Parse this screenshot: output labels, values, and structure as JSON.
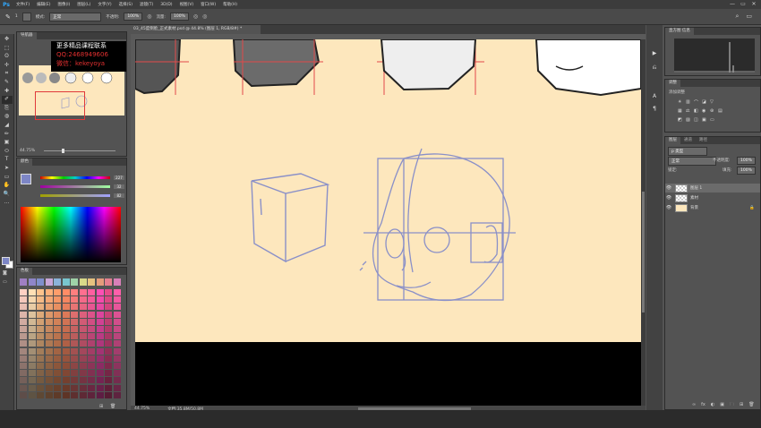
{
  "app": {
    "logo": "Ps",
    "accent": "#31a8ff"
  },
  "menu": [
    "文件(F)",
    "编辑(E)",
    "图像(I)",
    "图层(L)",
    "文字(Y)",
    "选择(S)",
    "滤镜(T)",
    "3D(D)",
    "视图(V)",
    "窗口(W)",
    "帮助(H)"
  ],
  "window_buttons": [
    "—",
    "▭",
    "✕"
  ],
  "options": {
    "brush_size": "1",
    "mode_label": "模式:",
    "mode_value": "正常",
    "opacity_label": "不透明:",
    "opacity_value": "100%",
    "flow_label": "流量:",
    "flow_value": "100%"
  },
  "document": {
    "tab_title": "03_45度侧脸_正式素材.psd @ 44.8% (图层 1, RGB/8#) *",
    "zoom": "44.75%",
    "doc_size": "文档:35.8M/50.8M",
    "canvas_color": "#fde7bd"
  },
  "navigator": {
    "tab": "导航器",
    "zoom": "44.75%",
    "banner": {
      "line1": "更多精品课程联系",
      "line2": "QQ:2468949606",
      "line3": "微信：kekeyoya"
    }
  },
  "color_panel": {
    "tab": "颜色",
    "r": "227",
    "g": "32",
    "b": "82",
    "fg_color": "#7d86c6"
  },
  "swatches_panel": {
    "tab": "色板",
    "top_colors": [
      "#9f7fc3",
      "#8f86c9",
      "#7f8fcc",
      "#c9a6d8",
      "#8bb3d9",
      "#79c6cf",
      "#9fd2a8",
      "#d8d889",
      "#e6c27f",
      "#e59c7b",
      "#e57f8f",
      "#d87fb8"
    ],
    "grid_colors": [
      "#ffd1c4",
      "#ffe0b5",
      "#ffc38c",
      "#ffb07a",
      "#ff9d6b",
      "#ff8c66",
      "#ff7f7f",
      "#ff6f8f",
      "#ff5fa0",
      "#ff4fb5",
      "#e84b8a",
      "#ff5faa"
    ],
    "grid_rows": 15
  },
  "histogram_panel": {
    "tab": "直方图 信息"
  },
  "adjust_panel": {
    "tab": "调整",
    "hint": "添加调整"
  },
  "layers_panel": {
    "tabs": [
      "图层",
      "通道",
      "路径"
    ],
    "kind": "p 类型",
    "blend": "正常",
    "opacity_label": "不透明度:",
    "opacity": "100%",
    "lock_label": "锁定:",
    "fill_label": "填充:",
    "fill": "100%",
    "layers": [
      {
        "name": "图层 1",
        "selected": true
      },
      {
        "name": "素材",
        "selected": false
      },
      {
        "name": "背景",
        "selected": false
      }
    ],
    "bottom_icons": [
      "∞",
      "fx",
      "◐",
      "▣",
      "🗀",
      "⊞",
      "🗑"
    ]
  },
  "tools": [
    "✥",
    "⬚",
    "ʘ",
    "✢",
    "⌗",
    "✎",
    "✚",
    "✐",
    "⎘",
    "◍",
    "◢",
    "✏",
    "▣",
    "⬭",
    "T",
    "➤",
    "▭",
    "✋",
    "🔍",
    "…"
  ]
}
